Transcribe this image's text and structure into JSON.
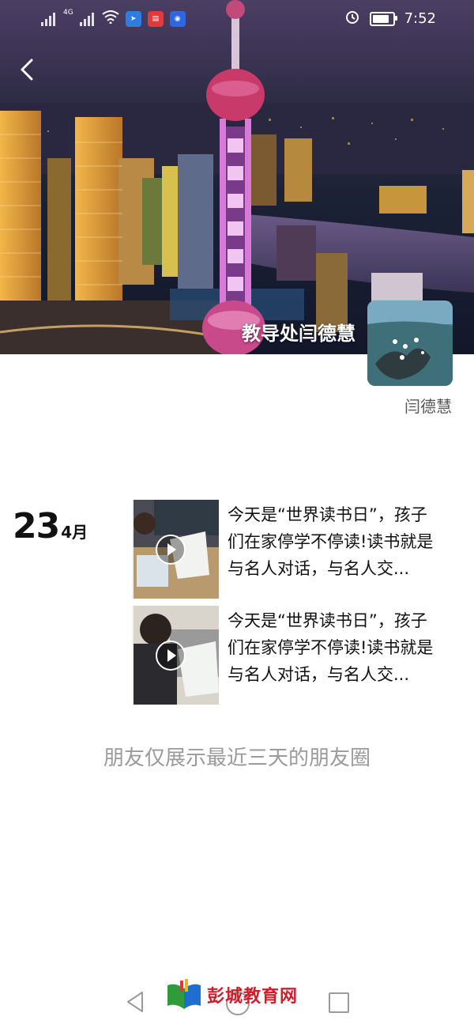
{
  "status_bar": {
    "network": "4G",
    "time": "7:52"
  },
  "header": {
    "cover_caption": "教导处闫德慧",
    "profile_name": "闫德慧"
  },
  "feed": {
    "date": {
      "day": "23",
      "month": "4月"
    },
    "posts": [
      {
        "text_line1": "今天是“世界读书日”，孩子",
        "text_line2": "们在家停学不停读!读书就是",
        "text_line3": "与名人对话，与名人交..."
      },
      {
        "text_line1": "今天是“世界读书日”，孩子",
        "text_line2": "们在家停学不停读!读书就是",
        "text_line3": "与名人对话，与名人交..."
      }
    ],
    "notice": "朋友仅展示最近三天的朋友圈"
  },
  "watermark": {
    "text": "彭城教育网"
  },
  "colors": {
    "accent_red": "#d21c2a",
    "muted_text": "#9a9a9a"
  }
}
